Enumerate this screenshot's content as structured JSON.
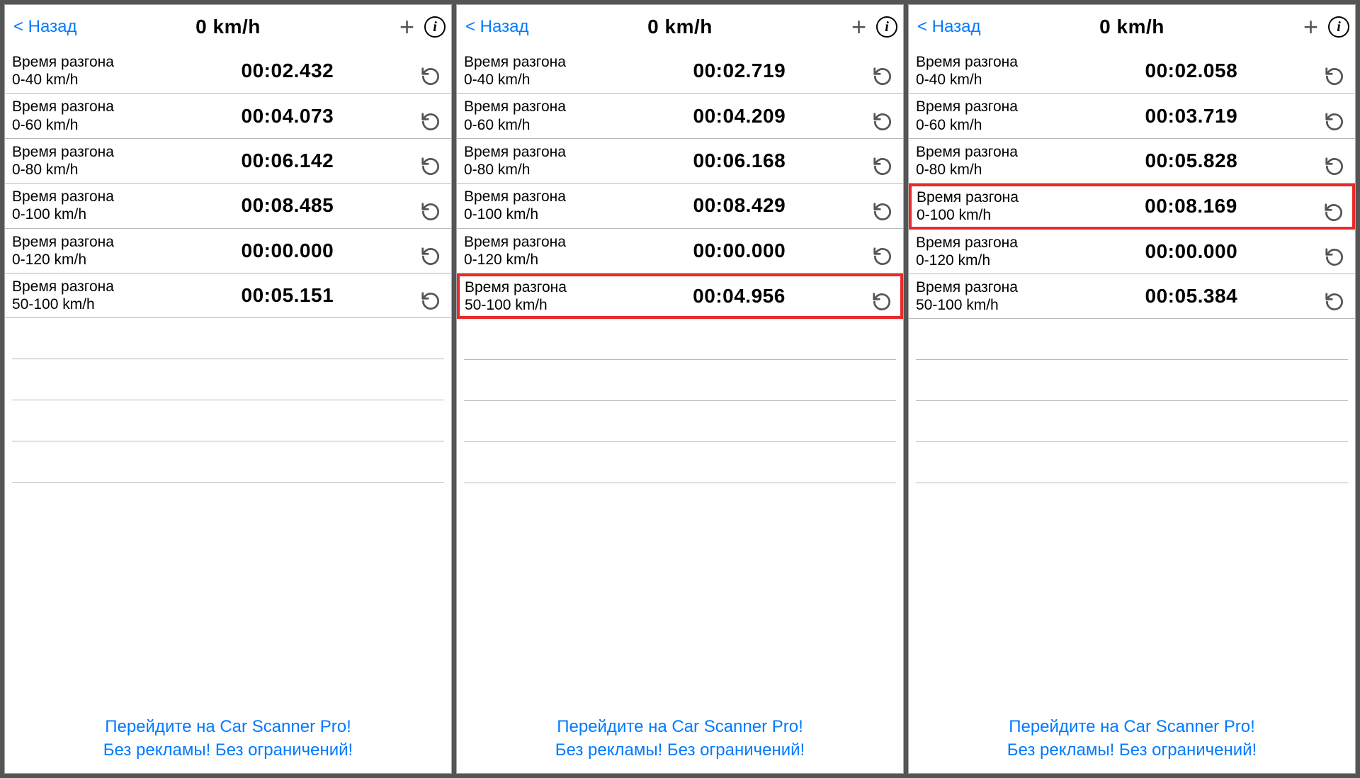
{
  "labels": {
    "back": "< Назад",
    "title_speed": "0 km/h",
    "accel_label": "Время разгона",
    "footer_line1": "Перейдите на Car Scanner Pro!",
    "footer_line2": "Без рекламы! Без ограничений!"
  },
  "panels": [
    {
      "rows": [
        {
          "range": "0-40 km/h",
          "time": "00:02.432",
          "highlight": false
        },
        {
          "range": "0-60 km/h",
          "time": "00:04.073",
          "highlight": false
        },
        {
          "range": "0-80 km/h",
          "time": "00:06.142",
          "highlight": false
        },
        {
          "range": "0-100 km/h",
          "time": "00:08.485",
          "highlight": false
        },
        {
          "range": "0-120 km/h",
          "time": "00:00.000",
          "highlight": false
        },
        {
          "range": "50-100 km/h",
          "time": "00:05.151",
          "highlight": false
        }
      ]
    },
    {
      "rows": [
        {
          "range": "0-40 km/h",
          "time": "00:02.719",
          "highlight": false
        },
        {
          "range": "0-60 km/h",
          "time": "00:04.209",
          "highlight": false
        },
        {
          "range": "0-80 km/h",
          "time": "00:06.168",
          "highlight": false
        },
        {
          "range": "0-100 km/h",
          "time": "00:08.429",
          "highlight": false
        },
        {
          "range": "0-120 km/h",
          "time": "00:00.000",
          "highlight": false
        },
        {
          "range": "50-100 km/h",
          "time": "00:04.956",
          "highlight": true
        }
      ]
    },
    {
      "rows": [
        {
          "range": "0-40 km/h",
          "time": "00:02.058",
          "highlight": false
        },
        {
          "range": "0-60 km/h",
          "time": "00:03.719",
          "highlight": false
        },
        {
          "range": "0-80 km/h",
          "time": "00:05.828",
          "highlight": false
        },
        {
          "range": "0-100 km/h",
          "time": "00:08.169",
          "highlight": true
        },
        {
          "range": "0-120 km/h",
          "time": "00:00.000",
          "highlight": false
        },
        {
          "range": "50-100 km/h",
          "time": "00:05.384",
          "highlight": false
        }
      ]
    }
  ],
  "empty_rows_per_panel": 4
}
